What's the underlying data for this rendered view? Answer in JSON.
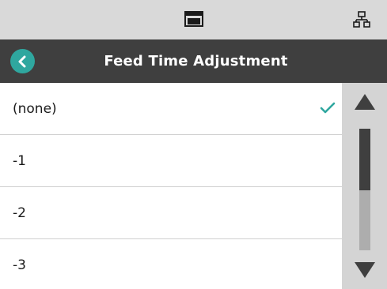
{
  "status_bar": {
    "icons": [
      "window-icon",
      "network-icon"
    ]
  },
  "header": {
    "back_icon": "back-arrow-icon",
    "title": "Feed Time Adjustment",
    "accent_color": "#2fa79f",
    "bar_color": "#3f3f3f"
  },
  "list": {
    "items": [
      {
        "label": "(none)",
        "selected": true
      },
      {
        "label": "-1",
        "selected": false
      },
      {
        "label": "-2",
        "selected": false
      },
      {
        "label": "-3",
        "selected": false
      }
    ],
    "check_icon": "checkmark-icon",
    "check_color": "#2fa79f"
  },
  "scrollbar": {
    "up_icon": "scroll-up-arrow-icon",
    "down_icon": "scroll-down-arrow-icon",
    "position_fraction": 0
  }
}
